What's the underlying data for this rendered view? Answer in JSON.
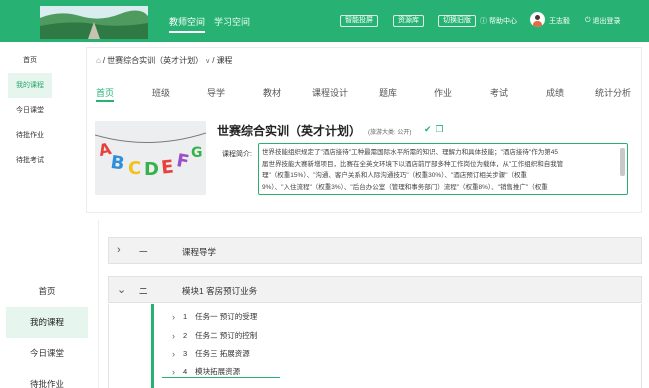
{
  "header": {
    "tabs": [
      "教师空间",
      "学习空间"
    ],
    "buttons": [
      "智能投屏",
      "资源库",
      "切换旧版"
    ],
    "help": "帮助中心",
    "user": "王志毅",
    "logout": "退出登录",
    "accent": "#27b274"
  },
  "nav": [
    "首页",
    "我的课程",
    "今日课堂",
    "待批作业",
    "待批考试"
  ],
  "nav_lower": [
    "首页",
    "我的课程",
    "今日课堂",
    "待批作业"
  ],
  "breadcrumb": {
    "course": "世赛综合实训（英才计划）",
    "current": "课程"
  },
  "tabs": [
    "首页",
    "班级",
    "导学",
    "教材",
    "课程设计",
    "题库",
    "作业",
    "考试",
    "成绩",
    "统计分析"
  ],
  "course": {
    "title": "世赛综合实训（英才计划）",
    "meta": "(旅游大类: 公开)",
    "intro_label": "课程简介:",
    "intro_lines": [
      "世界技能组织规定了\"酒店接待\"工种最需国际水平所需的知识、理解力和具体技能；\"酒店接待\"作为第45",
      "届世界技能大赛新增项目，比赛在全英文环境下以酒店前厅部多种工作岗位为载体，从\"工作组织和自我管",
      "理\"（权重15%）、\"沟通、客户关系和人际沟通技巧\"（权重30%）、\"酒店预订相关步骤\"（权重",
      "9%）、\"入住流程\"（权重3%）、\"后台办公室（管理和事务部门）流程\"（权重8%）、\"销售推广\"（权重"
    ]
  },
  "chapters": [
    {
      "num": "一",
      "name": "课程导学"
    },
    {
      "num": "二",
      "name": "模块1 客房预订业务"
    }
  ],
  "lessons": [
    {
      "num": "1",
      "name": "任务一 预订的受理"
    },
    {
      "num": "2",
      "name": "任务二 预订的控制"
    },
    {
      "num": "3",
      "name": "任务三 拓展资源"
    },
    {
      "num": "4",
      "name": "模块拓展资源"
    }
  ]
}
